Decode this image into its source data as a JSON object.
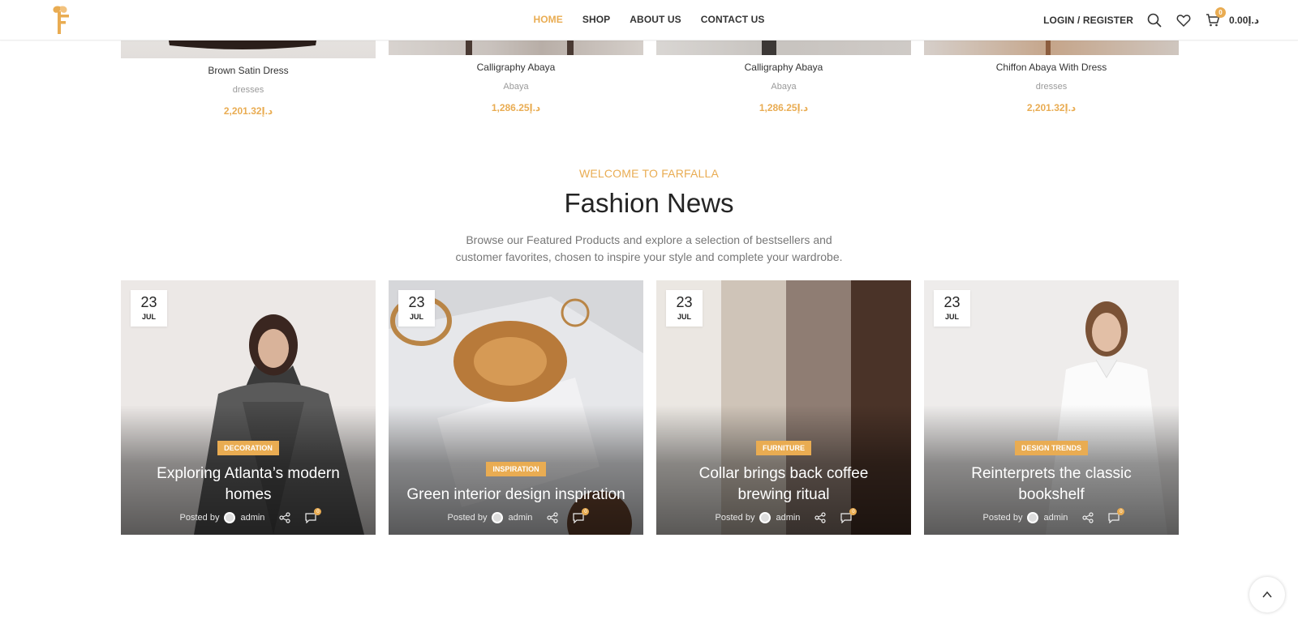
{
  "header": {
    "nav": [
      {
        "label": "HOME",
        "active": true
      },
      {
        "label": "SHOP",
        "active": false
      },
      {
        "label": "ABOUT US",
        "active": false
      },
      {
        "label": "CONTACT US",
        "active": false
      }
    ],
    "login_label": "LOGIN / REGISTER",
    "cart_count": "0",
    "cart_total": "0.00د.إ"
  },
  "products": [
    {
      "name": "Brown Satin Dress",
      "category": "dresses",
      "price": "2,201.32د.إ"
    },
    {
      "name": "Calligraphy Abaya",
      "category": "Abaya",
      "price": "1,286.25د.إ"
    },
    {
      "name": "Calligraphy Abaya",
      "category": "Abaya",
      "price": "1,286.25د.إ"
    },
    {
      "name": "Chiffon Abaya With Dress",
      "category": "dresses",
      "price": "2,201.32د.إ"
    }
  ],
  "news": {
    "subtitle": "WELCOME TO FARFALLA",
    "title": "Fashion News",
    "description": "Browse our Featured Products and explore a selection of bestsellers and customer favorites, chosen to inspire your style and complete your wardrobe.",
    "posts": [
      {
        "day": "23",
        "month": "JUL",
        "category": "DECORATION",
        "title": "Exploring Atlanta’s modern homes",
        "posted_by": "Posted by",
        "author": "admin",
        "comments": "0"
      },
      {
        "day": "23",
        "month": "JUL",
        "category": "INSPIRATION",
        "title": "Green interior design inspiration",
        "posted_by": "Posted by",
        "author": "admin",
        "comments": "0"
      },
      {
        "day": "23",
        "month": "JUL",
        "category": "FURNITURE",
        "title": "Collar brings back coffee brewing ritual",
        "posted_by": "Posted by",
        "author": "admin",
        "comments": "0"
      },
      {
        "day": "23",
        "month": "JUL",
        "category": "DESIGN TRENDS",
        "title": "Reinterprets the classic bookshelf",
        "posted_by": "Posted by",
        "author": "admin",
        "comments": "0"
      }
    ]
  },
  "colors": {
    "accent": "#e9ac52",
    "text": "#242424",
    "muted": "#777777"
  }
}
